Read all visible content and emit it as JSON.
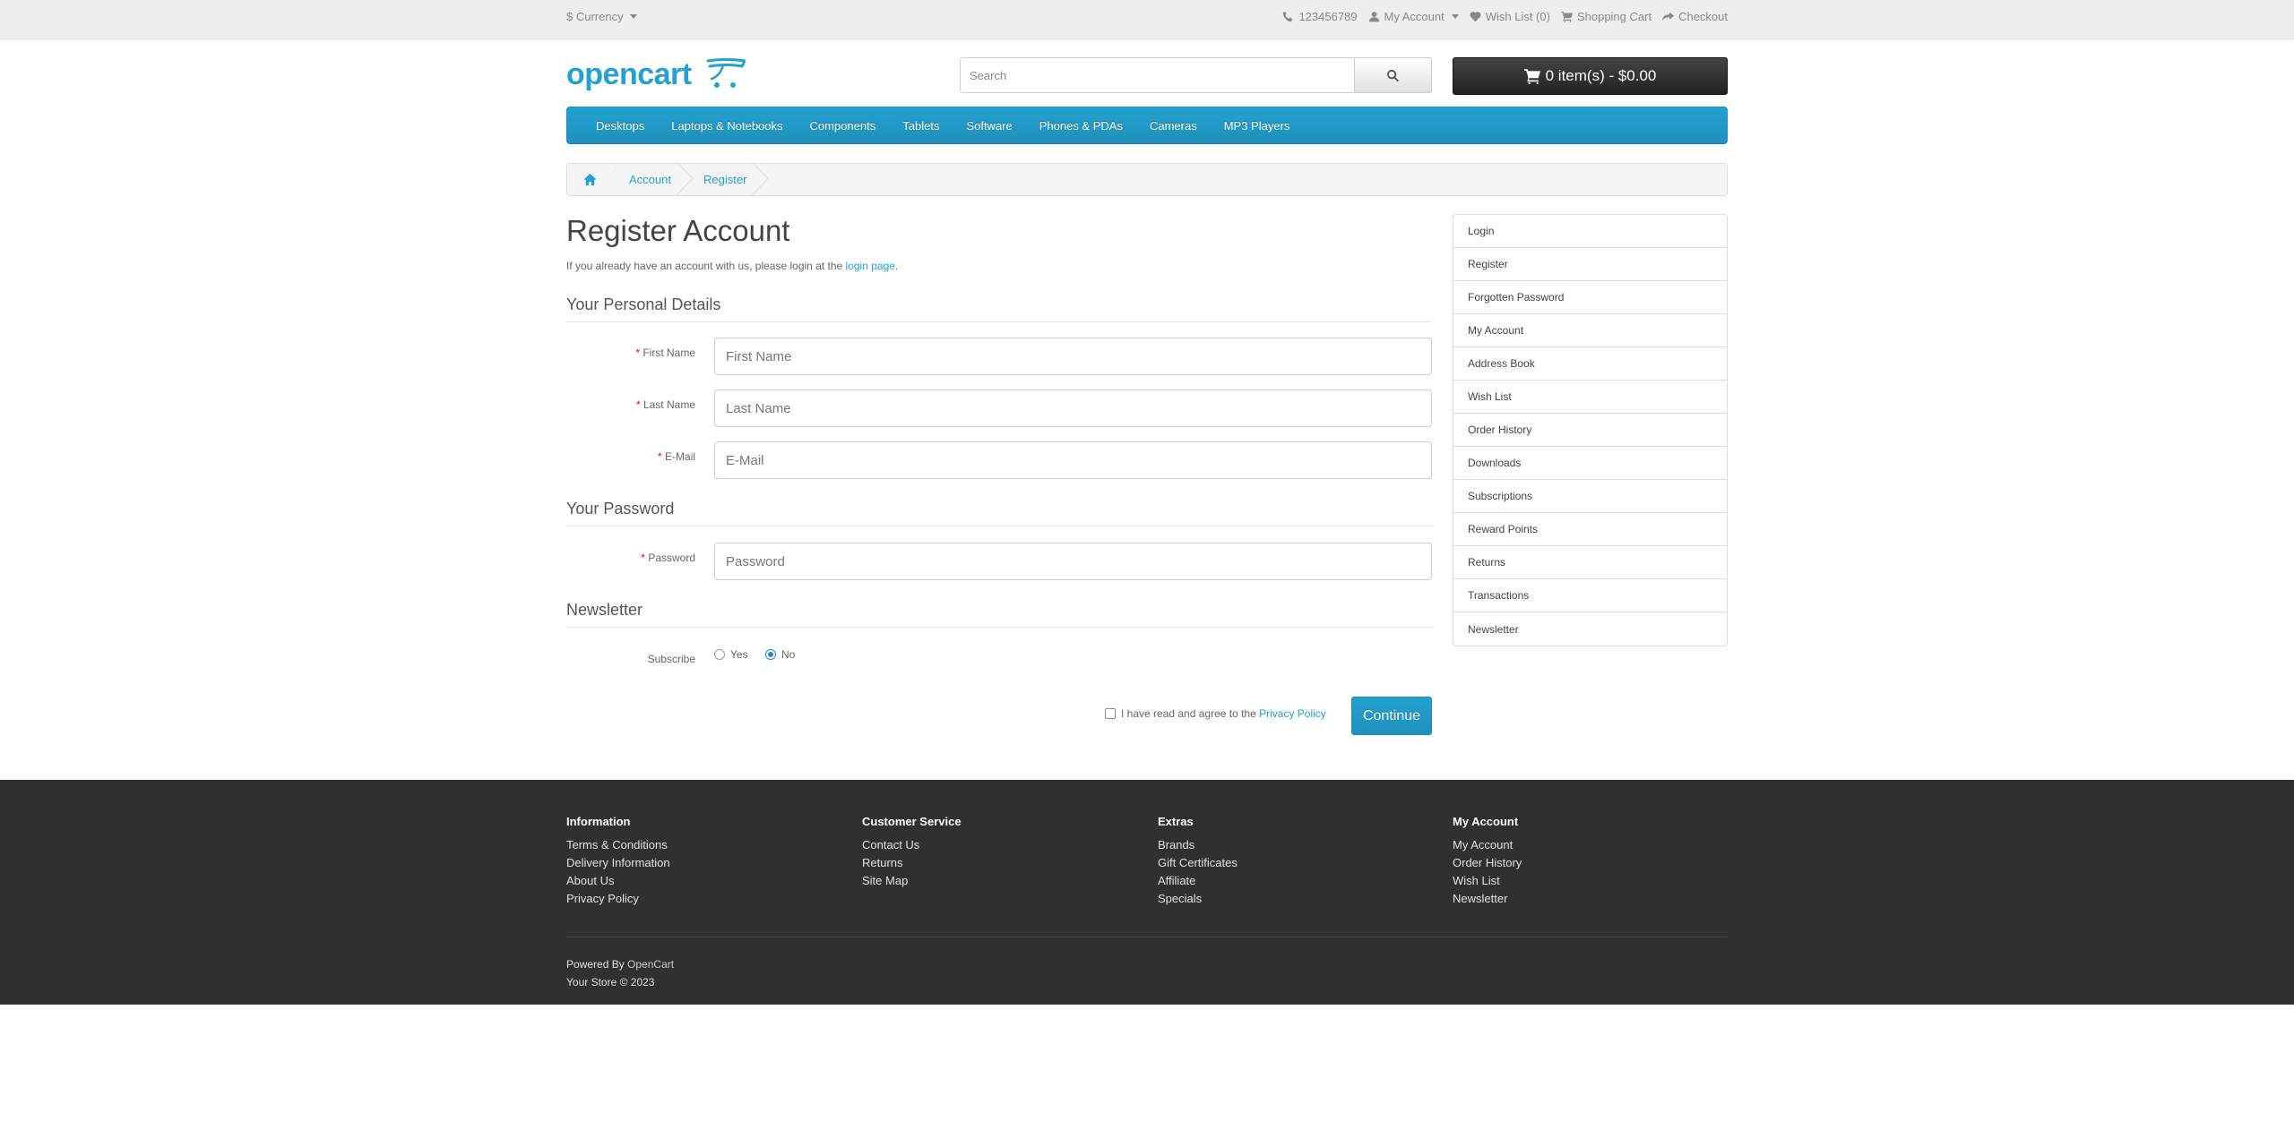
{
  "topbar": {
    "currency_label": "$ Currency",
    "phone": "123456789",
    "my_account": "My Account",
    "wish_list": "Wish List (0)",
    "shopping_cart": "Shopping Cart",
    "checkout": "Checkout"
  },
  "header": {
    "logo_text": "opencart",
    "search_placeholder": "Search",
    "cart_label": "0 item(s) - $0.00"
  },
  "menu": [
    "Desktops",
    "Laptops & Notebooks",
    "Components",
    "Tablets",
    "Software",
    "Phones & PDAs",
    "Cameras",
    "MP3 Players"
  ],
  "breadcrumb": [
    "Account",
    "Register"
  ],
  "page": {
    "title": "Register Account",
    "intro_prefix": "If you already have an account with us, please login at the ",
    "intro_link": "login page",
    "intro_suffix": "."
  },
  "form": {
    "personal_legend": "Your Personal Details",
    "first_name_label": "First Name",
    "first_name_placeholder": "First Name",
    "last_name_label": "Last Name",
    "last_name_placeholder": "Last Name",
    "email_label": "E-Mail",
    "email_placeholder": "E-Mail",
    "password_legend": "Your Password",
    "password_label": "Password",
    "password_placeholder": "Password",
    "newsletter_legend": "Newsletter",
    "subscribe_label": "Subscribe",
    "yes_label": "Yes",
    "no_label": "No",
    "subscribe_selected": "No",
    "agree_text": "I have read and agree to the ",
    "agree_link": "Privacy Policy",
    "continue_label": "Continue",
    "required_mark": "*"
  },
  "sidebar": [
    "Login",
    "Register",
    "Forgotten Password",
    "My Account",
    "Address Book",
    "Wish List",
    "Order History",
    "Downloads",
    "Subscriptions",
    "Reward Points",
    "Returns",
    "Transactions",
    "Newsletter"
  ],
  "footer": {
    "columns": [
      {
        "heading": "Information",
        "links": [
          "Terms & Conditions",
          "Delivery Information",
          "About Us",
          "Privacy Policy"
        ]
      },
      {
        "heading": "Customer Service",
        "links": [
          "Contact Us",
          "Returns",
          "Site Map"
        ]
      },
      {
        "heading": "Extras",
        "links": [
          "Brands",
          "Gift Certificates",
          "Affiliate",
          "Specials"
        ]
      },
      {
        "heading": "My Account",
        "links": [
          "My Account",
          "Order History",
          "Wish List",
          "Newsletter"
        ]
      }
    ],
    "powered_prefix": "Powered By ",
    "powered_link": "OpenCart",
    "copyright": "Your Store © 2023"
  },
  "colors": {
    "accent": "#23a1d1",
    "topbar_bg": "#eeeeee",
    "footer_bg": "#303030",
    "cart_bg": "#222222"
  }
}
